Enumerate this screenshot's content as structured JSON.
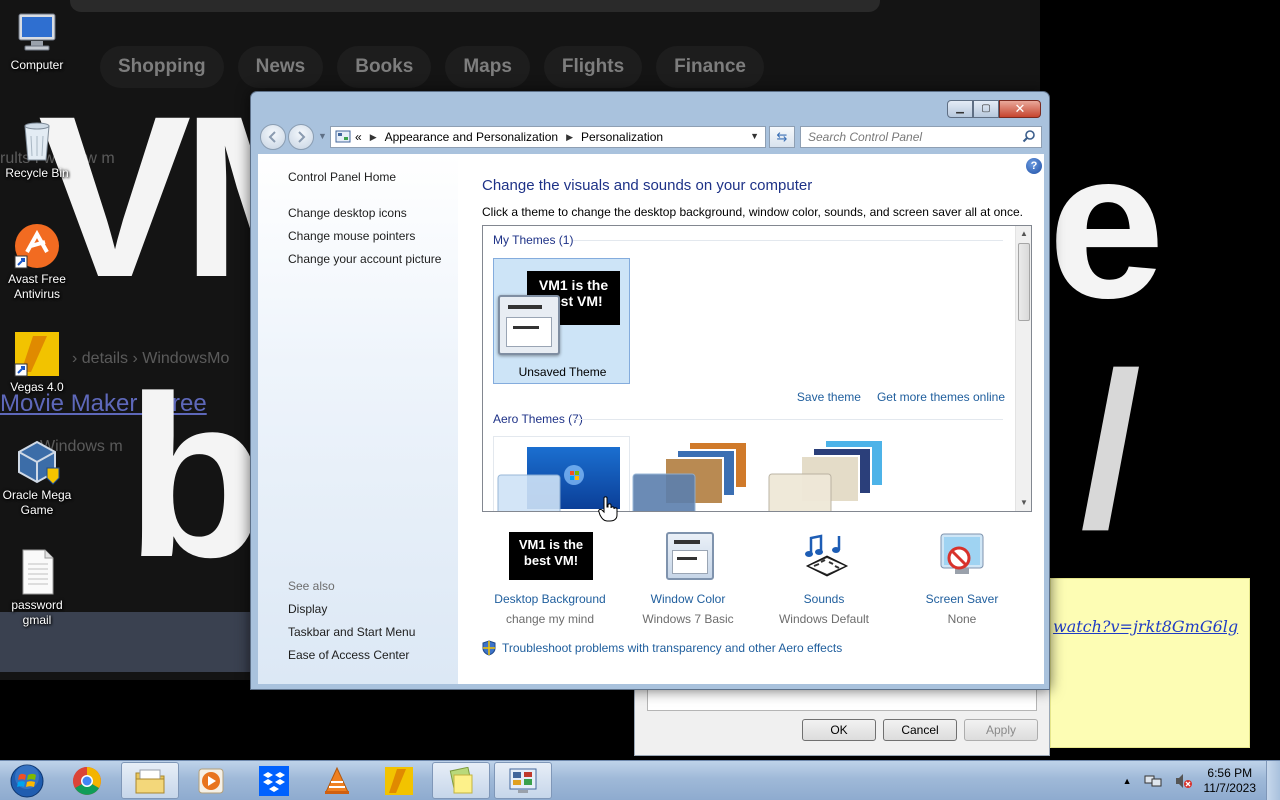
{
  "background": {
    "browser_tabs": [
      "Shopping",
      "News",
      "Books",
      "Maps",
      "Flights",
      "Finance"
    ],
    "big_text_top": "VM",
    "big_text_right": "e",
    "big_text_bottom": "b",
    "big_text_slash": "/",
    "faded_link": "Movie Maker : Free",
    "faded_line_1": "rults f window m",
    "faded_line_2": "› details › WindowsMo",
    "faded_line_3": "Windows m"
  },
  "desktop_icons": [
    {
      "label": "Computer"
    },
    {
      "label": "Recycle Bin"
    },
    {
      "label": "Avast Free Antivirus"
    },
    {
      "label": "Vegas 4.0"
    },
    {
      "label": "Oracle Mega Game"
    },
    {
      "label": "password gmail"
    }
  ],
  "sticky_note": {
    "text": "watch?v=jrkt8GmG6lg"
  },
  "behind_dialog": {
    "buttons": [
      "OK",
      "Cancel",
      "Apply"
    ]
  },
  "window": {
    "address": {
      "prefix": "«",
      "crumbs": [
        "Appearance and Personalization",
        "Personalization"
      ]
    },
    "search_placeholder": "Search Control Panel",
    "sidebar": {
      "home": "Control Panel Home",
      "tasks": [
        "Change desktop icons",
        "Change mouse pointers",
        "Change your account picture"
      ],
      "see_also_label": "See also",
      "see_also": [
        "Display",
        "Taskbar and Start Menu",
        "Ease of Access Center"
      ]
    },
    "heading": "Change the visuals and sounds on your computer",
    "subtitle": "Click a theme to change the desktop background, window color, sounds, and screen saver all at once.",
    "my_themes": {
      "header": "My Themes (1)",
      "selected_theme": {
        "label": "Unsaved Theme",
        "thumb_text": "VM1 is the best VM!"
      },
      "save_link": "Save theme",
      "more_link": "Get more themes online"
    },
    "aero_themes": {
      "header": "Aero Themes (7)"
    },
    "quick_settings": [
      {
        "label": "Desktop Background",
        "value": "change my mind",
        "thumb_text": "VM1 is the best VM!"
      },
      {
        "label": "Window Color",
        "value": "Windows 7 Basic"
      },
      {
        "label": "Sounds",
        "value": "Windows Default"
      },
      {
        "label": "Screen Saver",
        "value": "None"
      }
    ],
    "troubleshoot_link": "Troubleshoot problems with transparency and other Aero effects",
    "help": "?"
  },
  "taskbar": {
    "clock_time": "6:56 PM",
    "clock_date": "11/7/2023"
  }
}
